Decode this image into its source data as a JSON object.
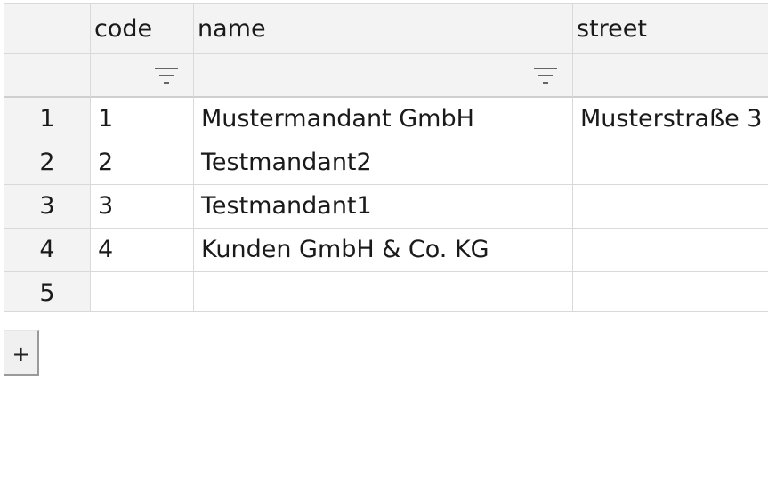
{
  "columns": [
    {
      "key": "code",
      "label": "code",
      "filterable": true
    },
    {
      "key": "name",
      "label": "name",
      "filterable": true
    },
    {
      "key": "street",
      "label": "street",
      "filterable": false
    }
  ],
  "rows": [
    {
      "num": "1",
      "code": "1",
      "name": "Mustermandant GmbH",
      "street": "Musterstraße 3"
    },
    {
      "num": "2",
      "code": "2",
      "name": "Testmandant2",
      "street": ""
    },
    {
      "num": "3",
      "code": "3",
      "name": "Testmandant1",
      "street": ""
    },
    {
      "num": "4",
      "code": "4",
      "name": "Kunden GmbH & Co. KG",
      "street": ""
    },
    {
      "num": "5",
      "code": "",
      "name": "",
      "street": ""
    }
  ],
  "add_row_button": {
    "label": "+"
  },
  "icons": {
    "filter": "filter-icon"
  },
  "colors": {
    "header_bg": "#f3f3f3",
    "grid_line": "#d9d9d9",
    "icon": "#666666"
  }
}
